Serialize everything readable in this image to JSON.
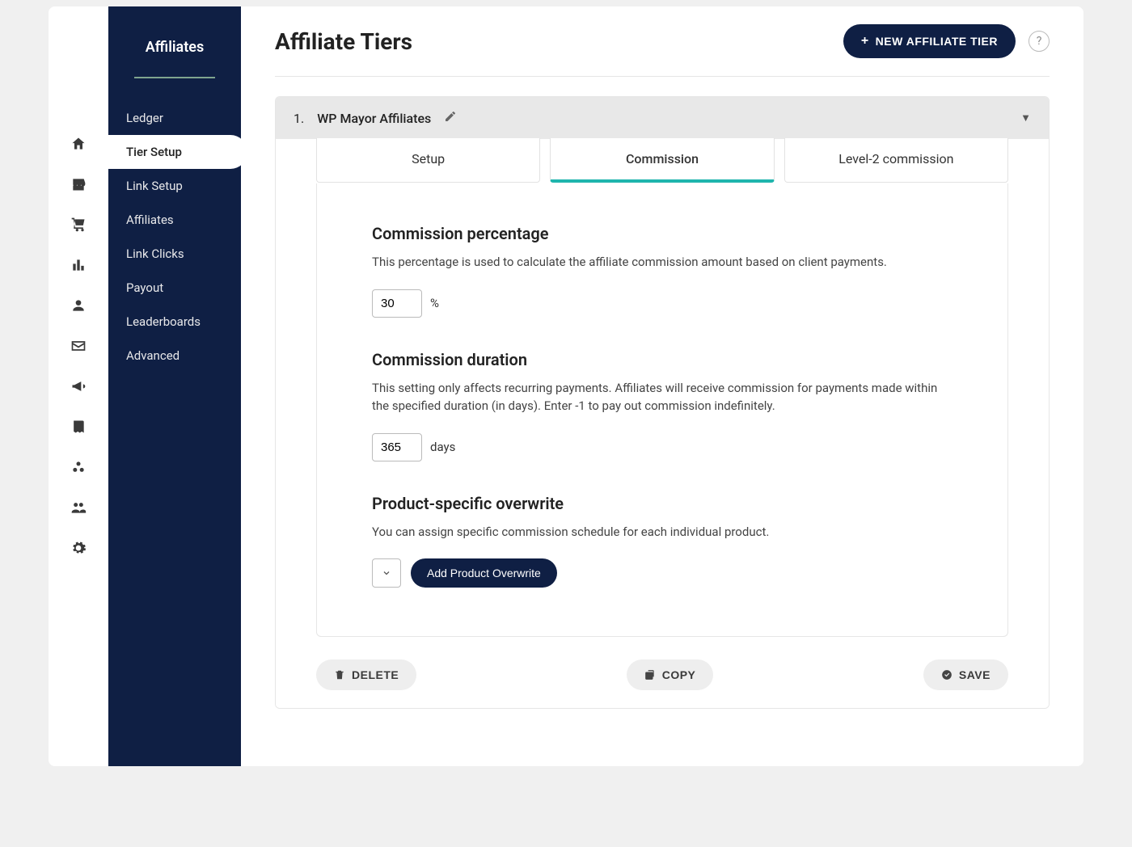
{
  "sidebar": {
    "title": "Affiliates",
    "items": [
      {
        "label": "Ledger"
      },
      {
        "label": "Tier Setup",
        "active": true
      },
      {
        "label": "Link Setup"
      },
      {
        "label": "Affiliates"
      },
      {
        "label": "Link Clicks"
      },
      {
        "label": "Payout"
      },
      {
        "label": "Leaderboards"
      },
      {
        "label": "Advanced"
      }
    ]
  },
  "page": {
    "title": "Affiliate Tiers",
    "new_tier_label": "NEW AFFILIATE TIER"
  },
  "tier": {
    "index": "1.",
    "name": "WP Mayor Affiliates",
    "tabs": {
      "setup": "Setup",
      "commission": "Commission",
      "level2": "Level-2 commission"
    },
    "commission_percentage": {
      "title": "Commission percentage",
      "desc": "This percentage is used to calculate the affiliate commission amount based on client payments.",
      "value": "30",
      "unit": "%"
    },
    "commission_duration": {
      "title": "Commission duration",
      "desc": "This setting only affects recurring payments. Affiliates will receive commission for payments made within the specified duration (in days). Enter -1 to pay out commission indefinitely.",
      "value": "365",
      "unit": "days"
    },
    "product_overwrite": {
      "title": "Product-specific overwrite",
      "desc": "You can assign specific commission schedule for each individual product.",
      "button": "Add Product Overwrite"
    }
  },
  "actions": {
    "delete": "DELETE",
    "copy": "COPY",
    "save": "SAVE"
  }
}
